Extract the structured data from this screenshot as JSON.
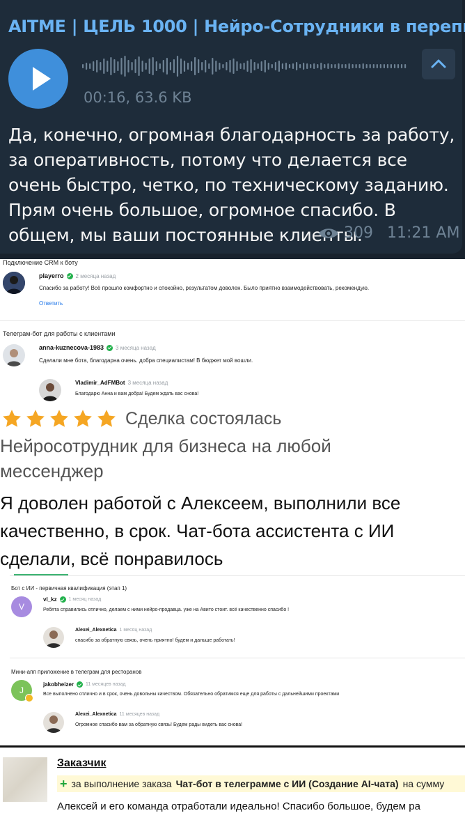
{
  "telegram": {
    "channel_title": "AITME | ЦЕЛЬ 1000 | Нейро-Сотрудники в перепи...",
    "voice_meta": "00:16, 63.6 KB",
    "message_text": "Да, конечно, огромная благодарность за работу, за оперативность, потому что делается все очень быстро, четко, по техническому заданию. Прям очень большое, огромное спасибо. В общем, мы ваши постоянные клиенты.",
    "views": "309",
    "time": "11:21 AM",
    "colors": {
      "background": "#1e2c3a",
      "accent": "#6ab3f3",
      "play_button": "#3f8fdb"
    }
  },
  "review_block_1": {
    "section_1_title": "Подключение CRM к боту",
    "review_1": {
      "author": "playerro",
      "date": "2 месяца назад",
      "text": "Спасибо за работу! Всё прошло комфортно и спокойно, результатом доволен. Было приятно взаимодействовать, рекомендую.",
      "reply_link": "Ответить"
    },
    "section_2_title": "Телеграм-бот для работы с клиентами",
    "review_2": {
      "author": "anna-kuznecova-1983",
      "date": "3 месяца назад",
      "text": "Сделали мне бота, благодарна очень. добра специалистам! В бюджет мой вошли."
    },
    "reply_2": {
      "author": "Vladimir_AdFMBot",
      "date": "3 месяца назад",
      "text": "Благодарю Анна и вам добра! Будем ждать вас снова!"
    }
  },
  "deal_review": {
    "stars": 5,
    "status": "Сделка состоялась",
    "title": "Нейросотрудник для бизнеса на любой мессенджер",
    "text": "Я доволен работой с Алексеем, выполнили все качественно, в срок. Чат-бота ассистента с ИИ сделали, всё понравилось",
    "star_color": "#f5a623"
  },
  "review_block_2": {
    "section_1_title": "Бот с ИИ - первичная квалификация (этап 1)",
    "review_1": {
      "avatar_letter": "V",
      "author": "vl_kz",
      "date": "1 месяц назад",
      "text": "Ребята справились отлично, делаем с ними нейро-продавца. уже на Авито стоит. всё качественно спасибо !"
    },
    "reply_1": {
      "author": "Alexei_Alexnetica",
      "date": "1 месяц назад",
      "text": "спасибо за обратную связь, очень приятно! будем и дальше работать!"
    },
    "section_2_title": "Мини-апп приложение в телеграм для ресторанов",
    "review_2": {
      "avatar_letter": "J",
      "author": "jakobheizer",
      "date": "11 месяцев назад",
      "text": "Все выполнено отлично и в срок, очень довольны качеством. Обязательно обратимся еще для работы с дальнейшими проектами"
    },
    "reply_2": {
      "author": "Alexei_Alexnetica",
      "date": "11 месяцев назад",
      "text": "Огромное спасибо вам за обратную связь! Будем рады видеть вас снова!"
    }
  },
  "customer_review": {
    "label": "Заказчик",
    "prefix": "за выполнение заказа",
    "order_title": "Чат-бот в телеграмме с ИИ (Создание AI-чата)",
    "suffix": "на сумму",
    "text": "Алексей и его команда отработали идеально! Спасибо большое, будем ра"
  }
}
